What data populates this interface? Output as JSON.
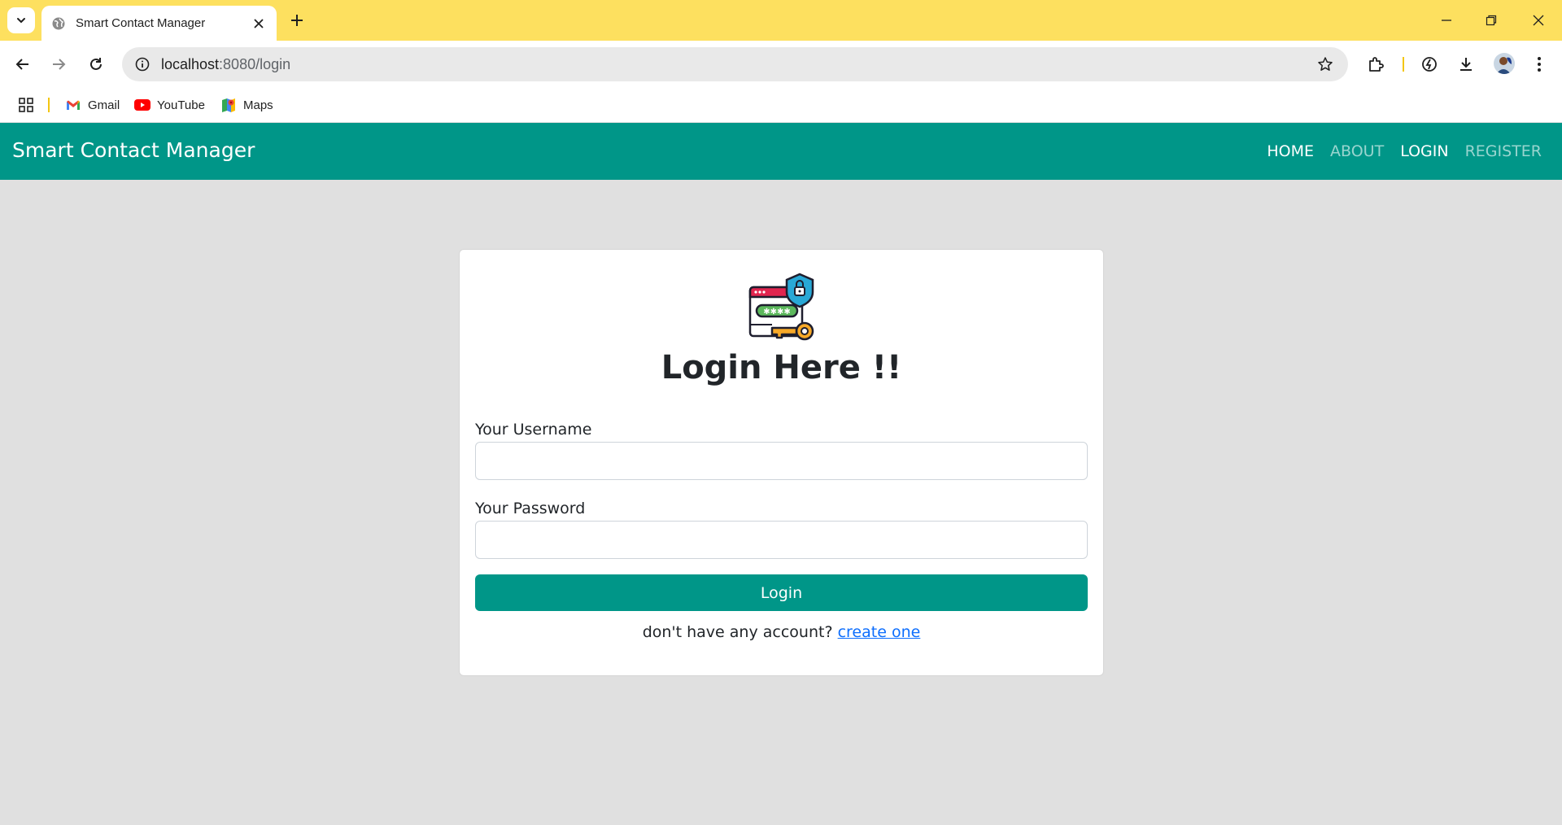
{
  "browser": {
    "tab_title": "Smart Contact Manager",
    "url_host": "localhost",
    "url_path": ":8080/login",
    "bookmarks": [
      {
        "label": "Gmail",
        "icon": "gmail-icon"
      },
      {
        "label": "YouTube",
        "icon": "youtube-icon"
      },
      {
        "label": "Maps",
        "icon": "maps-icon"
      }
    ],
    "accent_color": "#fde05f"
  },
  "navbar": {
    "brand": "Smart Contact Manager",
    "links": [
      {
        "label": "HOME"
      },
      {
        "label": "ABOUT"
      },
      {
        "label": "LOGIN"
      },
      {
        "label": "REGISTER"
      }
    ],
    "color": "#009688"
  },
  "login": {
    "title": "Login Here !!",
    "username_label": "Your Username",
    "username_value": "",
    "password_label": "Your Password",
    "password_value": "",
    "button_label": "Login",
    "signup_text": "don't have any account?",
    "signup_link": "create one",
    "logo_icon": "login-security-icon"
  }
}
